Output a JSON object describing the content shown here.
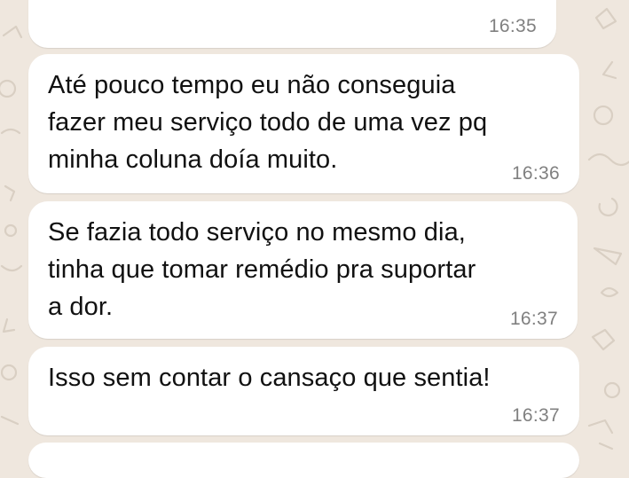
{
  "colors": {
    "wallpaper": "#efe7de",
    "bubble": "#ffffff",
    "text": "#111111",
    "timestamp": "#808080"
  },
  "messages": [
    {
      "text": "",
      "time": "16:35"
    },
    {
      "text": "Até pouco tempo eu não conseguia\nfazer meu serviço todo de uma vez pq\nminha coluna doía muito.",
      "time": "16:36"
    },
    {
      "text": "Se fazia todo serviço no mesmo dia,\ntinha que tomar remédio pra suportar\na dor.",
      "time": "16:37"
    },
    {
      "text": "Isso sem contar o cansaço que sentia!",
      "time": "16:37"
    }
  ]
}
